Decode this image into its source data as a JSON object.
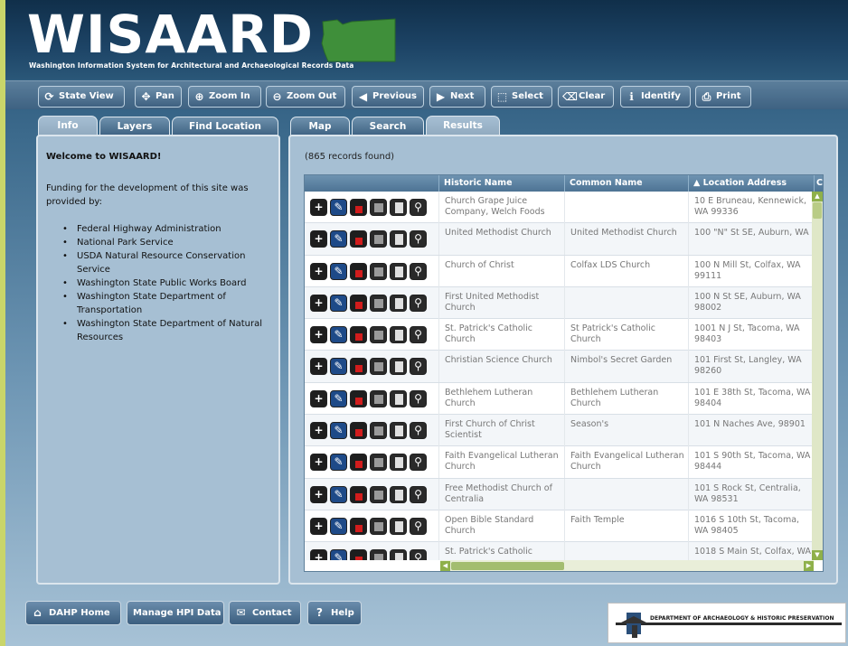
{
  "header": {
    "app_title": "WISAARD",
    "tagline": "Washington Information System for Architectural and Archaeological Records Data"
  },
  "toolbar": [
    {
      "label": "State View",
      "icon": "refresh-icon"
    },
    {
      "label": "Pan",
      "icon": "pan-arrows-icon"
    },
    {
      "label": "Zoom In",
      "icon": "zoom-in-icon"
    },
    {
      "label": "Zoom Out",
      "icon": "zoom-out-icon"
    },
    {
      "label": "Previous",
      "icon": "previous-extent-icon"
    },
    {
      "label": "Next",
      "icon": "next-extent-icon"
    },
    {
      "label": "Select",
      "icon": "select-icon"
    },
    {
      "label": "Clear",
      "icon": "clear-icon"
    },
    {
      "label": "Identify",
      "icon": "identify-icon"
    },
    {
      "label": "Print",
      "icon": "print-icon"
    }
  ],
  "left_tabs": [
    {
      "label": "Info",
      "active": true
    },
    {
      "label": "Layers",
      "active": false
    },
    {
      "label": "Find Location",
      "active": false
    }
  ],
  "info": {
    "welcome": "Welcome to WISAARD!",
    "funding_text": "Funding for the development of this site was provided by:",
    "funders": [
      "Federal Highway Administration",
      "National Park Service",
      "USDA Natural Resource Conservation Service",
      "Washington State Public Works Board",
      "Washington State Department of Transportation",
      "Washington State Department of Natural Resources"
    ]
  },
  "right_tabs": [
    {
      "label": "Map",
      "active": false
    },
    {
      "label": "Search",
      "active": false
    },
    {
      "label": "Results",
      "active": true
    }
  ],
  "results": {
    "count_text": "(865 records found)",
    "columns": {
      "historic_name": "Historic Name",
      "common_name": "Common Name",
      "location_address": "▲ Location Address",
      "next_col": "C"
    },
    "rows": [
      {
        "historic": "Church Grape Juice Company, Welch Foods",
        "common": "",
        "address": "10 E Bruneau, Kennewick, WA 99336"
      },
      {
        "historic": "United Methodist Church",
        "common": "United Methodist Church",
        "address": "100 \"N\" St SE, Auburn, WA"
      },
      {
        "historic": "Church of Christ",
        "common": "Colfax LDS Church",
        "address": "100 N Mill St, Colfax, WA 99111"
      },
      {
        "historic": "First United Methodist Church",
        "common": "",
        "address": "100 N St SE, Auburn, WA 98002"
      },
      {
        "historic": "St. Patrick's Catholic Church",
        "common": "St Patrick's Catholic Church",
        "address": "1001 N J St, Tacoma, WA 98403"
      },
      {
        "historic": "Christian Science Church",
        "common": "Nimbol's Secret Garden",
        "address": "101 First St, Langley, WA 98260"
      },
      {
        "historic": "Bethlehem Lutheran Church",
        "common": "Bethlehem Lutheran Church",
        "address": "101 E 38th St, Tacoma, WA 98404"
      },
      {
        "historic": "First Church of Christ Scientist",
        "common": "Season's",
        "address": "101 N Naches Ave, 98901"
      },
      {
        "historic": "Faith Evangelical Lutheran Church",
        "common": "Faith Evangelical Lutheran Church",
        "address": "101 S 90th St, Tacoma, WA 98444"
      },
      {
        "historic": "Free Methodist Church of Centralia",
        "common": "",
        "address": "101 S Rock St, Centralia, WA 98531"
      },
      {
        "historic": "Open Bible Standard Church",
        "common": "Faith Temple",
        "address": "1016 S 10th St, Tacoma, WA 98405"
      },
      {
        "historic": "St. Patrick's Catholic",
        "common": "",
        "address": "1018 S Main St, Colfax, WA"
      }
    ]
  },
  "footer": [
    {
      "label": "DAHP Home",
      "icon": "home-icon"
    },
    {
      "label": "Manage HPI Data",
      "icon": ""
    },
    {
      "label": "Contact",
      "icon": "envelope-icon"
    },
    {
      "label": "Help",
      "icon": "help-icon"
    }
  ],
  "dahp_logo_text": "DEPARTMENT OF ARCHAEOLOGY & HISTORIC PRESERVATION",
  "colors": {
    "accent_green": "#c9d56a",
    "header_navy": "#1d4466",
    "panel": "#a6bfd3"
  }
}
